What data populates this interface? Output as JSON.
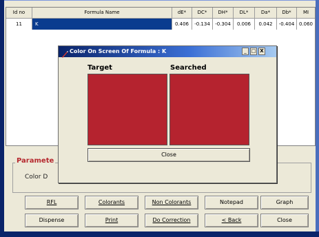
{
  "table": {
    "headers": [
      "Id no",
      "Formula Name",
      "dE*",
      "DC*",
      "DH*",
      "DL*",
      "Da*",
      "Db*",
      "MI"
    ],
    "rows": [
      [
        "11",
        "K",
        "0.406",
        "-0.134",
        "-0.304",
        "0.006",
        "0.042",
        "-0.404",
        "0.060"
      ]
    ]
  },
  "parameters": {
    "title": "Paramete",
    "label": "Color D"
  },
  "dialog": {
    "title": "Color On Screen Of Formula : K",
    "target_label": "Target",
    "searched_label": "Searched",
    "target_color": "#b5232f",
    "searched_color": "#b5232f",
    "close_label": "Close",
    "window_buttons": [
      "_",
      "□",
      "X"
    ]
  },
  "buttons": {
    "row1": [
      "RFL",
      "Colorants",
      "Non Colorants",
      "Notepad",
      "Graph"
    ],
    "row2": [
      "Dispense",
      "Print",
      "Do Correction",
      "< Back",
      "Close"
    ]
  },
  "colors": {
    "selection": "#0a3c8f",
    "frame_accent": "#0a246a",
    "group_title": "#b5282e"
  }
}
